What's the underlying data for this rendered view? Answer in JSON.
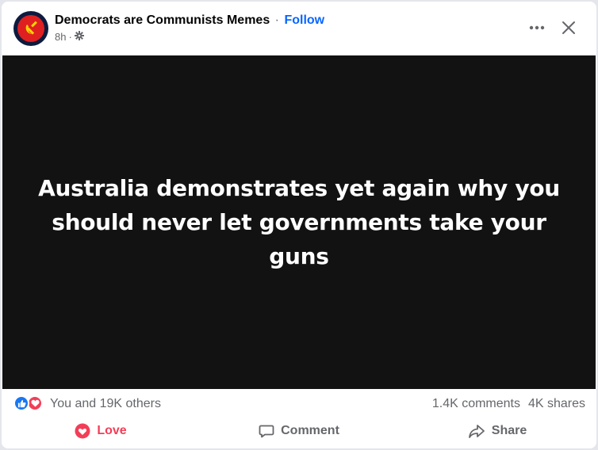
{
  "post": {
    "page_name": "Democrats are Communists Memes",
    "separator": "·",
    "follow_label": "Follow",
    "time": "8h",
    "time_separator": "·",
    "audience_icon": "gear-icon",
    "media_text": "Australia demonstrates yet again why you should never let governments take your guns"
  },
  "stats": {
    "reactions_text": "You and 19K others",
    "reaction_icons": [
      "like-icon",
      "love-icon"
    ],
    "comments": "1.4K comments",
    "shares": "4K shares"
  },
  "actions": {
    "love_label": "Love",
    "comment_label": "Comment",
    "share_label": "Share"
  },
  "colors": {
    "accent": "#0866ff",
    "love": "#f33e58",
    "like": "#1877f2",
    "media_bg": "#121212",
    "muted": "#65676b"
  }
}
